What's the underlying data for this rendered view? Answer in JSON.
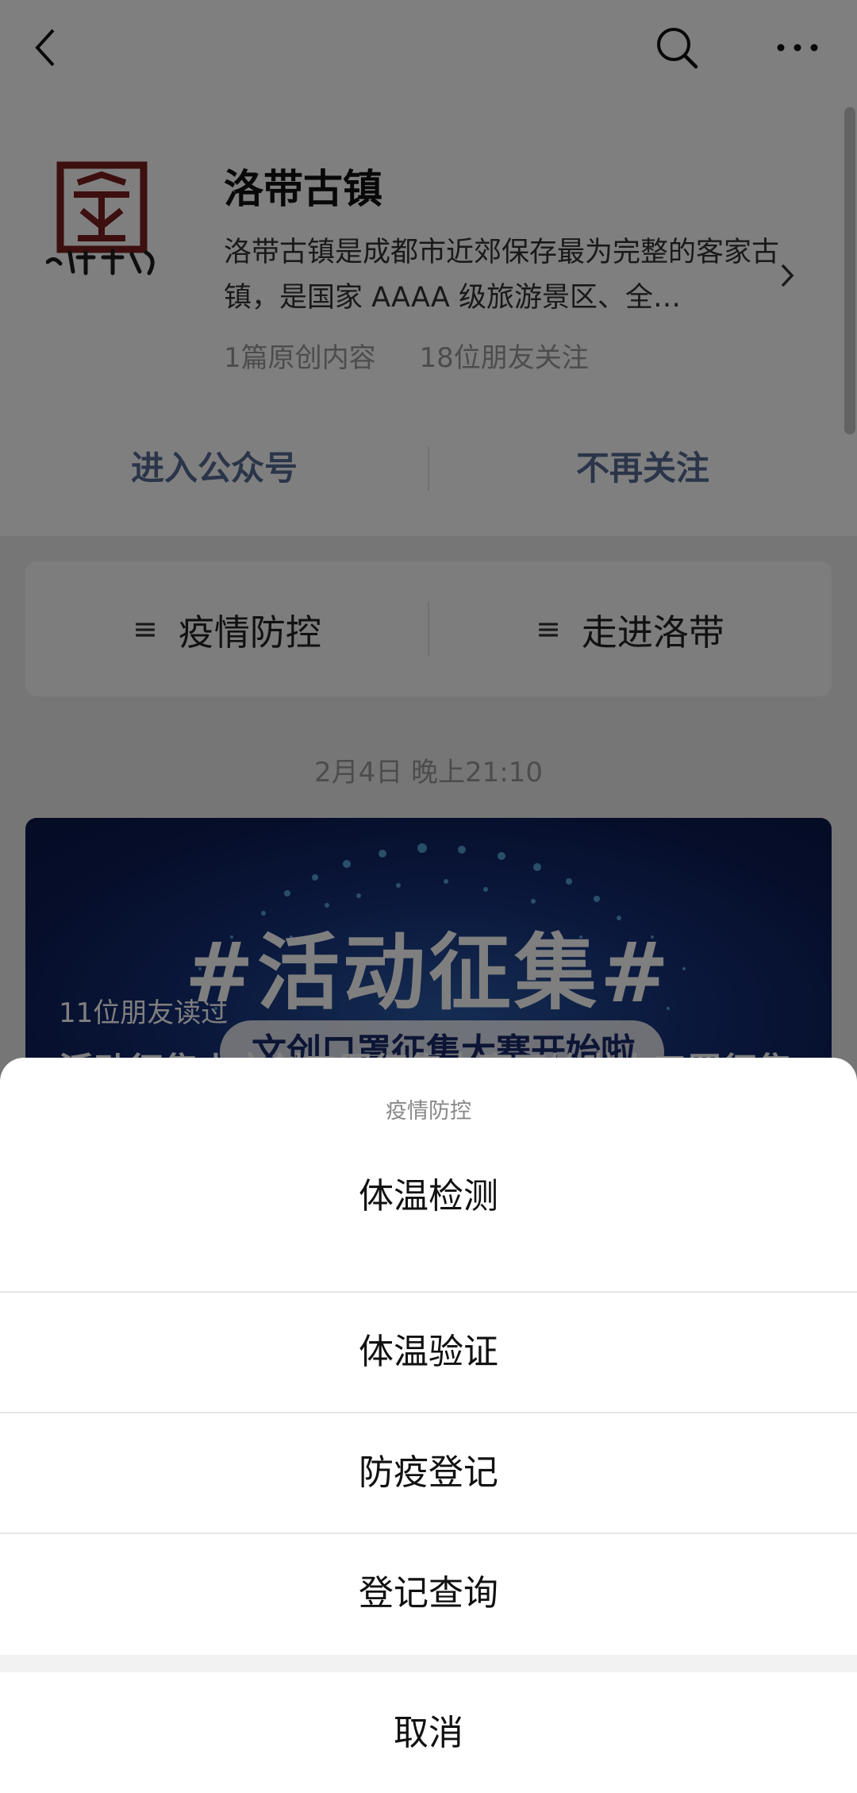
{
  "account": {
    "name": "洛带古镇",
    "logo_text": "洛带古镇",
    "description": "洛带古镇是成都市近郊保存最为完整的客家古镇，是国家 AAAA 级旅游景区、全…",
    "original_count": "1篇原创内容",
    "friends_following": "18位朋友关注",
    "enter_label": "进入公众号",
    "unfollow_label": "不再关注"
  },
  "menu": [
    {
      "label": "疫情防控"
    },
    {
      "label": "走进洛带"
    }
  ],
  "timestamp": "2月4日 晚上21:10",
  "article": {
    "banner_title": "#活动征集#",
    "banner_pill": "文创口罩征集大赛开始啦",
    "reads": "11位朋友读过",
    "title": "活动征集丨文创口罩征集大赛开始啦丨口罩征集"
  },
  "sheet": {
    "title": "疫情防控",
    "options": [
      "体温检测",
      "体温验证",
      "防疫登记",
      "登记查询"
    ],
    "cancel": "取消"
  },
  "colors": {
    "link": "#576b95",
    "overlay": "rgba(0,0,0,0.5)",
    "banner": "#16317a"
  },
  "icons": [
    "back-icon",
    "search-icon",
    "more-icon",
    "chevron-right-icon",
    "menu-list-icon"
  ]
}
